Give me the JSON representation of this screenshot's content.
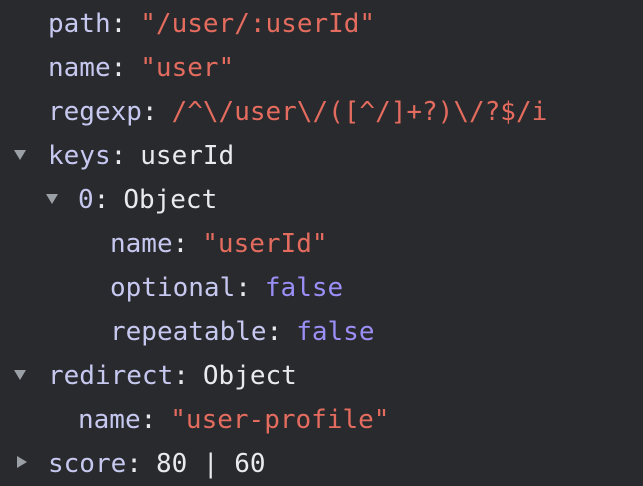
{
  "rows": [
    {
      "key": "path",
      "value": "\"/user/:userId\""
    },
    {
      "key": "name",
      "value": "\"user\""
    },
    {
      "key": "regexp",
      "value": "/^\\/user\\/([^/]+?)\\/?$/i"
    },
    {
      "key": "keys",
      "value": "userId"
    },
    {
      "key": "0",
      "value": "Object"
    },
    {
      "key": "name",
      "value": "\"userId\""
    },
    {
      "key": "optional",
      "value": "false"
    },
    {
      "key": "repeatable",
      "value": "false"
    },
    {
      "key": "redirect",
      "value": "Object"
    },
    {
      "key": "name",
      "value": "\"user-profile\""
    },
    {
      "key": "score",
      "value": "80 | 60"
    }
  ],
  "icons": {
    "expanded": "triangle-down-icon",
    "collapsed": "triangle-right-icon"
  },
  "colors": {
    "background": "#292a2d",
    "key": "#c6c8f0",
    "string": "#e46c5f",
    "boolean": "#9a8ff7",
    "plain": "#e8eaed",
    "arrow": "#9aa0a6"
  }
}
